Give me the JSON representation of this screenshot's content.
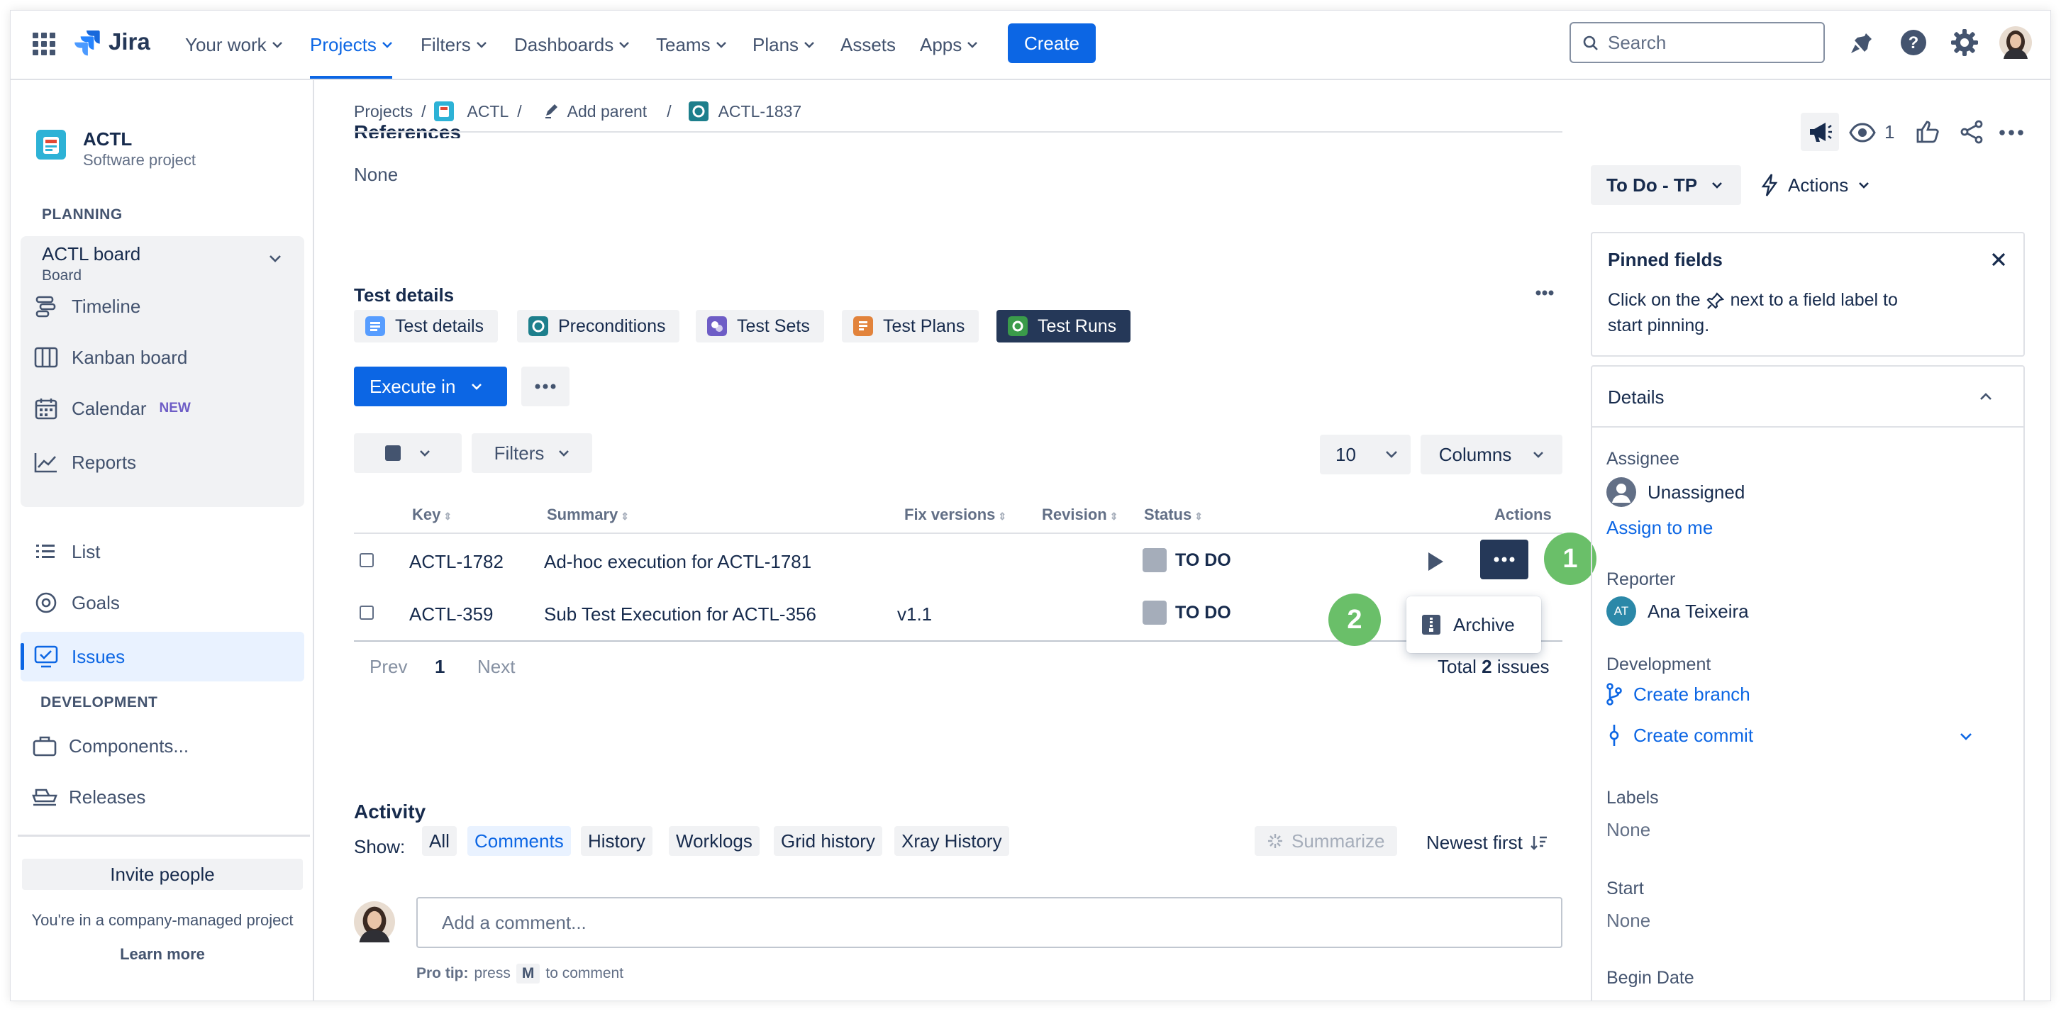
{
  "nav": {
    "logo": "Jira",
    "items": [
      {
        "label": "Your work",
        "dropdown": true
      },
      {
        "label": "Projects",
        "dropdown": true,
        "active": true
      },
      {
        "label": "Filters",
        "dropdown": true
      },
      {
        "label": "Dashboards",
        "dropdown": true
      },
      {
        "label": "Teams",
        "dropdown": true
      },
      {
        "label": "Plans",
        "dropdown": true
      },
      {
        "label": "Assets",
        "dropdown": false
      },
      {
        "label": "Apps",
        "dropdown": true
      }
    ],
    "create_label": "Create",
    "search_placeholder": "Search"
  },
  "sidebar": {
    "project_name": "ACTL",
    "project_type": "Software project",
    "planning_label": "PLANNING",
    "board_name": "ACTL board",
    "board_sub": "Board",
    "planning_items": [
      {
        "label": "Timeline",
        "icon": "timeline-icon"
      },
      {
        "label": "Kanban board",
        "icon": "kanban-icon"
      },
      {
        "label": "Calendar",
        "icon": "calendar-icon",
        "badge": "NEW"
      },
      {
        "label": "Reports",
        "icon": "reports-icon"
      }
    ],
    "other_items": [
      {
        "label": "List",
        "icon": "list-icon"
      },
      {
        "label": "Goals",
        "icon": "goals-icon"
      },
      {
        "label": "Issues",
        "icon": "issues-icon",
        "active": true
      }
    ],
    "development_label": "DEVELOPMENT",
    "dev_items": [
      {
        "label": "Components...",
        "icon": "components-icon"
      },
      {
        "label": "Releases",
        "icon": "releases-icon"
      }
    ],
    "invite_label": "Invite people",
    "managed_text": "You're in a company-managed project",
    "learn_more": "Learn more"
  },
  "breadcrumb": {
    "projects": "Projects",
    "project": "ACTL",
    "add_parent": "Add parent",
    "issue": "ACTL-1837"
  },
  "references": {
    "title": "References",
    "value": "None"
  },
  "test_details": {
    "title": "Test details",
    "tabs": [
      {
        "label": "Test details",
        "color": "#579dff"
      },
      {
        "label": "Preconditions",
        "color": "#1d7f8c"
      },
      {
        "label": "Test Sets",
        "color": "#6e5dc6"
      },
      {
        "label": "Test Plans",
        "color": "#e2833b"
      },
      {
        "label": "Test Runs",
        "color": "#3a9b4a",
        "active": true
      }
    ],
    "execute_label": "Execute in",
    "filters_label": "Filters",
    "page_size": "10",
    "columns_label": "Columns",
    "columns": [
      "Key",
      "Summary",
      "Fix versions",
      "Revision",
      "Status",
      "Actions"
    ],
    "rows": [
      {
        "key": "ACTL-1782",
        "summary": "Ad-hoc execution for ACTL-1781",
        "fix": "",
        "revision": "",
        "status": "TO DO"
      },
      {
        "key": "ACTL-359",
        "summary": "Sub Test Execution for ACTL-356",
        "fix": "v1.1",
        "revision": "",
        "status": "TO DO"
      }
    ],
    "menu_item": "Archive",
    "pagination": {
      "prev": "Prev",
      "page": "1",
      "next": "Next"
    },
    "total_prefix": "Total",
    "total_count": "2",
    "total_suffix": "issues",
    "badge1": "1",
    "badge2": "2"
  },
  "activity": {
    "title": "Activity",
    "show_label": "Show:",
    "filters": [
      "All",
      "Comments",
      "History",
      "Worklogs",
      "Grid history",
      "Xray History"
    ],
    "active_filter": "Comments",
    "summarize": "Summarize",
    "sort": "Newest first",
    "comment_placeholder": "Add a comment...",
    "pro_tip_label": "Pro tip:",
    "pro_tip_press": "press",
    "pro_tip_key": "M",
    "pro_tip_rest": "to comment"
  },
  "right": {
    "watchers": "1",
    "status_label": "To Do - TP",
    "actions_label": "Actions",
    "pinned_title": "Pinned fields",
    "pinned_text_1": "Click on the",
    "pinned_text_2": "next to a field label to",
    "pinned_text_3": "start pinning.",
    "details_title": "Details",
    "assignee_label": "Assignee",
    "assignee_value": "Unassigned",
    "assign_to_me": "Assign to me",
    "reporter_label": "Reporter",
    "reporter_initials": "AT",
    "reporter_value": "Ana Teixeira",
    "development_label": "Development",
    "create_branch": "Create branch",
    "create_commit": "Create commit",
    "labels_label": "Labels",
    "labels_value": "None",
    "start_label": "Start",
    "start_value": "None",
    "begin_label": "Begin Date"
  }
}
